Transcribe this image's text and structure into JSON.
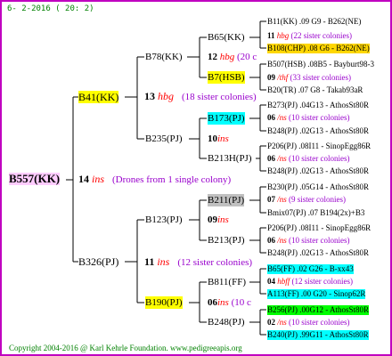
{
  "header": {
    "date": "6- 2-2016 ( 20: 2)"
  },
  "copyright": "Copyright 2004-2016 @ Karl Kehrle Foundation.   www.pedigreeapis.org",
  "root": {
    "id": "B557(KK)"
  },
  "gen1": {
    "top": {
      "id": "B41(KK)"
    },
    "mid_num": "14",
    "mid_ins": "ins",
    "mid_note": "(Drones from 1 single colony)",
    "bottom": {
      "id": "B326(PJ)"
    }
  },
  "gen2": {
    "b78": {
      "id": "B78(KK)"
    },
    "b78_mid_num": "13",
    "b78_mid_hbg": "hbg",
    "b78_mid_note": "(18 sister colonies)",
    "b235": {
      "id": "B235(PJ)"
    },
    "b123": {
      "id": "B123(PJ)"
    },
    "b326_mid_num": "11",
    "b326_mid_ins": "ins",
    "b326_mid_note": "(12 sister colonies)",
    "b190": {
      "id": "B190(PJ)"
    }
  },
  "gen3": {
    "b65": "B65(KK)",
    "b65_num": "12",
    "b65_hbg": "hbg",
    "b65_note": "(20 c",
    "b7": "B7(HSB)",
    "b173": "B173(PJ)",
    "b173_num": "10",
    "b173_ins": "ins",
    "b213h": "B213H(PJ)",
    "b211": "B211(PJ)",
    "b211_num": "09",
    "b211_ins": "ins",
    "b213": "B213(PJ)",
    "b811": "B811(FF)",
    "b811_num": "06",
    "b811_ins": "ins",
    "b811_note": "(10 c",
    "b248": "B248(PJ)"
  },
  "gen4": [
    {
      "text": "B11(KK) .09     G9 - B262(NE)"
    },
    {
      "num": "11",
      "ins": "hbg",
      "note": "(22 sister colonies)"
    },
    {
      "text": "B108(CHP) .08    G6 - B262(NE)"
    },
    {
      "text": "B507(HSB) .08B5 - Bayburt98-3"
    },
    {
      "num": "09",
      "ins": "/thf",
      "note": "(33 sister colonies)"
    },
    {
      "text": "B20(TR) .07    G8 - Takab93aR"
    },
    {
      "text": "B273(PJ) .04G13 - AthosSt80R"
    },
    {
      "num": "06",
      "ins": "/ns",
      "note": "(10 sister colonies)"
    },
    {
      "text": "B248(PJ) .02G13 - AthosSt80R"
    },
    {
      "text": "P206(PJ) .08I11 - SinopEgg86R"
    },
    {
      "num": "06",
      "ins": "/ns",
      "note": "(10 sister colonies)"
    },
    {
      "text": "B248(PJ) .02G13 - AthosSt80R"
    },
    {
      "text": "B230(PJ) .05G14 - AthosSt80R"
    },
    {
      "num": "07",
      "ins": "/ns",
      "note": "(9 sister colonies)"
    },
    {
      "text": "Bmix07(PJ) .07    B194(2x)+B3"
    },
    {
      "text": "P206(PJ) .08I11 - SinopEgg86R"
    },
    {
      "num": "06",
      "ins": "/ns",
      "note": "(10 sister colonies)"
    },
    {
      "text": "B248(PJ) .02G13 - AthosSt80R"
    },
    {
      "text": "B65(FF) .02        G26 - B-xx43"
    },
    {
      "num": "04",
      "ins": "hbff",
      "note": "(12 sister colonies)"
    },
    {
      "text": "A113(FF) .00    G20 - Sinop62R"
    },
    {
      "text": "B256(PJ) .00G12 - AthosSt80R"
    },
    {
      "num": "02",
      "ins": "/ns",
      "note": "(10 sister colonies)"
    },
    {
      "text": "B240(PJ) .99G11 - AthosSt80R"
    }
  ]
}
